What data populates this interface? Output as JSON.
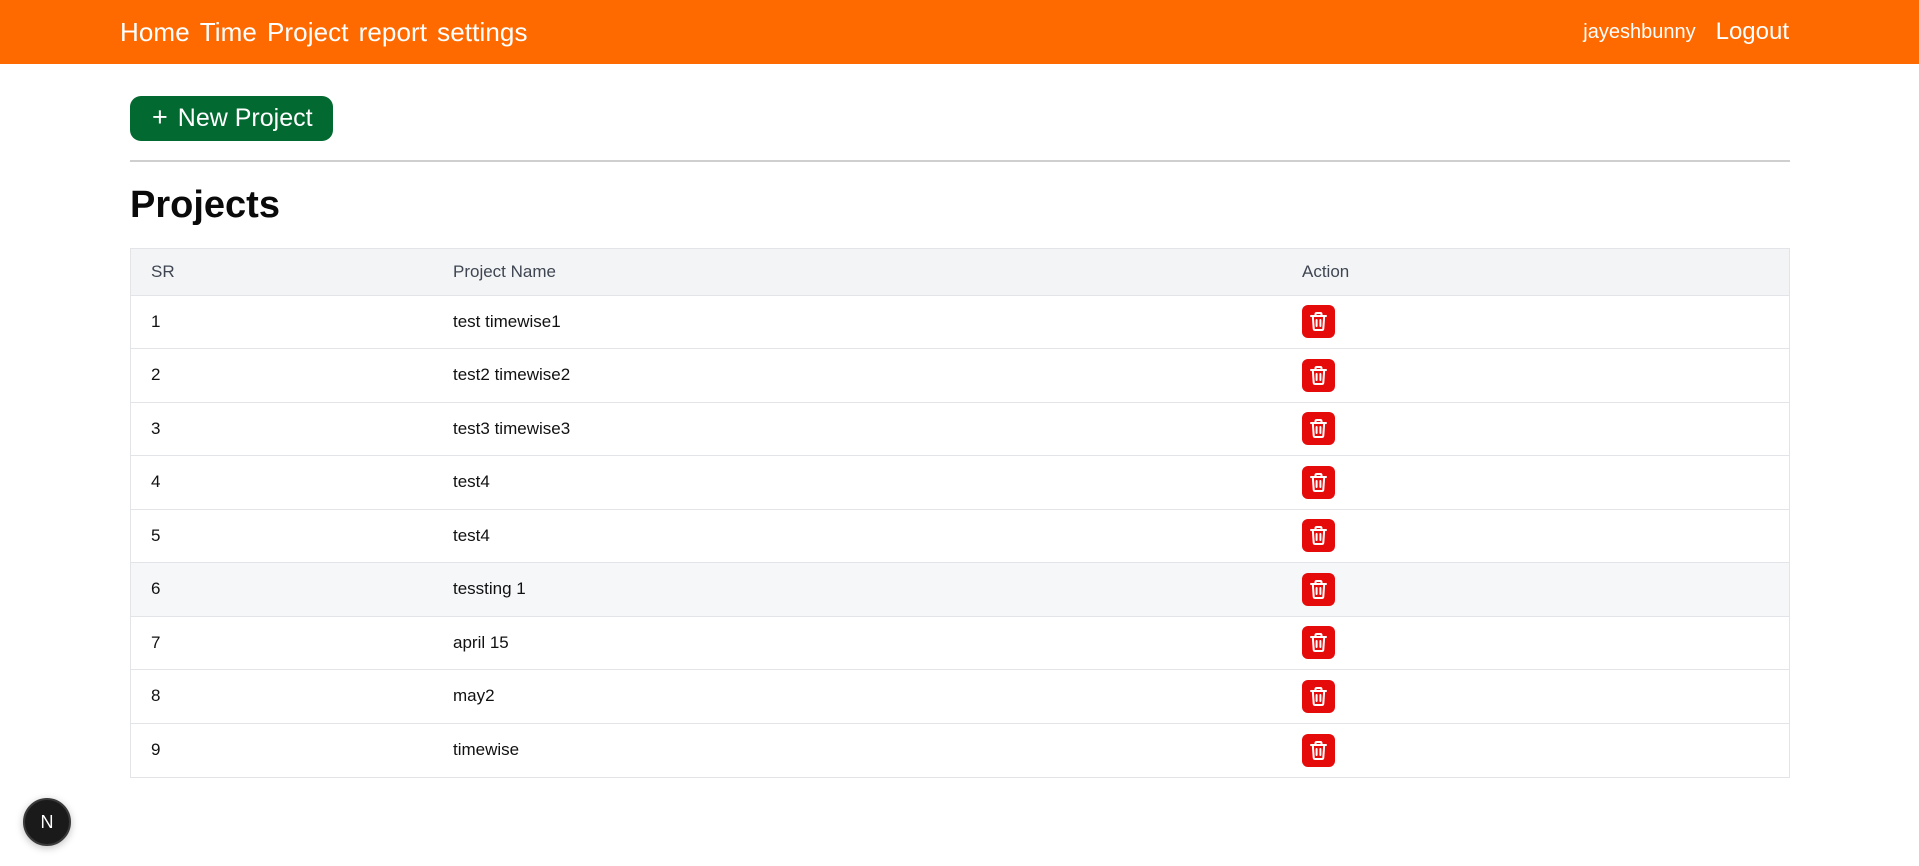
{
  "nav": {
    "links": [
      "Home",
      "Time",
      "Project",
      "report",
      "settings"
    ],
    "username": "jayeshbunny",
    "logout": "Logout"
  },
  "toolbar": {
    "new_project_label": "New Project",
    "plus_icon": "+"
  },
  "page": {
    "title": "Projects"
  },
  "table": {
    "headers": [
      "SR",
      "Project Name",
      "Action"
    ],
    "rows": [
      {
        "sr": "1",
        "name": "test timewise1"
      },
      {
        "sr": "2",
        "name": "test2 timewise2"
      },
      {
        "sr": "3",
        "name": "test3 timewise3"
      },
      {
        "sr": "4",
        "name": "test4"
      },
      {
        "sr": "5",
        "name": "test4"
      },
      {
        "sr": "6",
        "name": "tessting 1"
      },
      {
        "sr": "7",
        "name": "april 15"
      },
      {
        "sr": "8",
        "name": "may2"
      },
      {
        "sr": "9",
        "name": "timewise"
      }
    ],
    "action_icon": "trash-icon"
  },
  "badge": {
    "letter": "N",
    "icon": "nextjs-icon"
  },
  "colors": {
    "topbar": "#ff6a00",
    "primary_button": "#026930",
    "delete_button": "#e60b0b",
    "header_row": "#f3f4f6"
  }
}
